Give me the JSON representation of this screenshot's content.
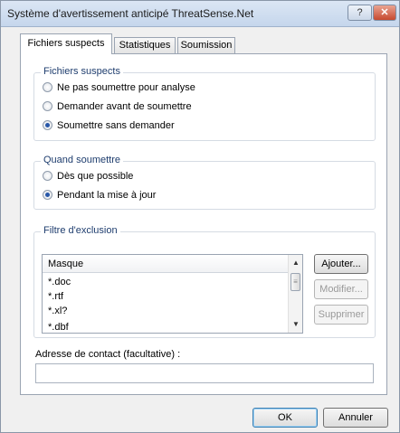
{
  "window": {
    "title": "Système d'avertissement anticipé ThreatSense.Net",
    "help_glyph": "?",
    "close_glyph": "✕"
  },
  "tabs": [
    {
      "label": "Fichiers suspects",
      "active": true
    },
    {
      "label": "Statistiques",
      "active": false
    },
    {
      "label": "Soumission",
      "active": false
    }
  ],
  "suspect_files": {
    "legend": "Fichiers suspects",
    "options": [
      {
        "label": "Ne pas soumettre pour analyse",
        "selected": false
      },
      {
        "label": "Demander avant de soumettre",
        "selected": false
      },
      {
        "label": "Soumettre sans demander",
        "selected": true
      }
    ]
  },
  "when_submit": {
    "legend": "Quand soumettre",
    "options": [
      {
        "label": "Dès que possible",
        "selected": false
      },
      {
        "label": "Pendant la mise à jour",
        "selected": true
      }
    ]
  },
  "exclusion_filter": {
    "legend": "Filtre d'exclusion",
    "column_header": "Masque",
    "rows": [
      "*.doc",
      "*.rtf",
      "*.xl?",
      "*.dbf"
    ],
    "buttons": {
      "add": "Ajouter...",
      "modify": "Modifier...",
      "delete": "Supprimer"
    }
  },
  "contact": {
    "label": "Adresse de contact (facultative) :",
    "value": ""
  },
  "footer": {
    "ok": "OK",
    "cancel": "Annuler"
  },
  "colors": {
    "accent": "#2857a8",
    "legend_text": "#1e3d6e"
  }
}
